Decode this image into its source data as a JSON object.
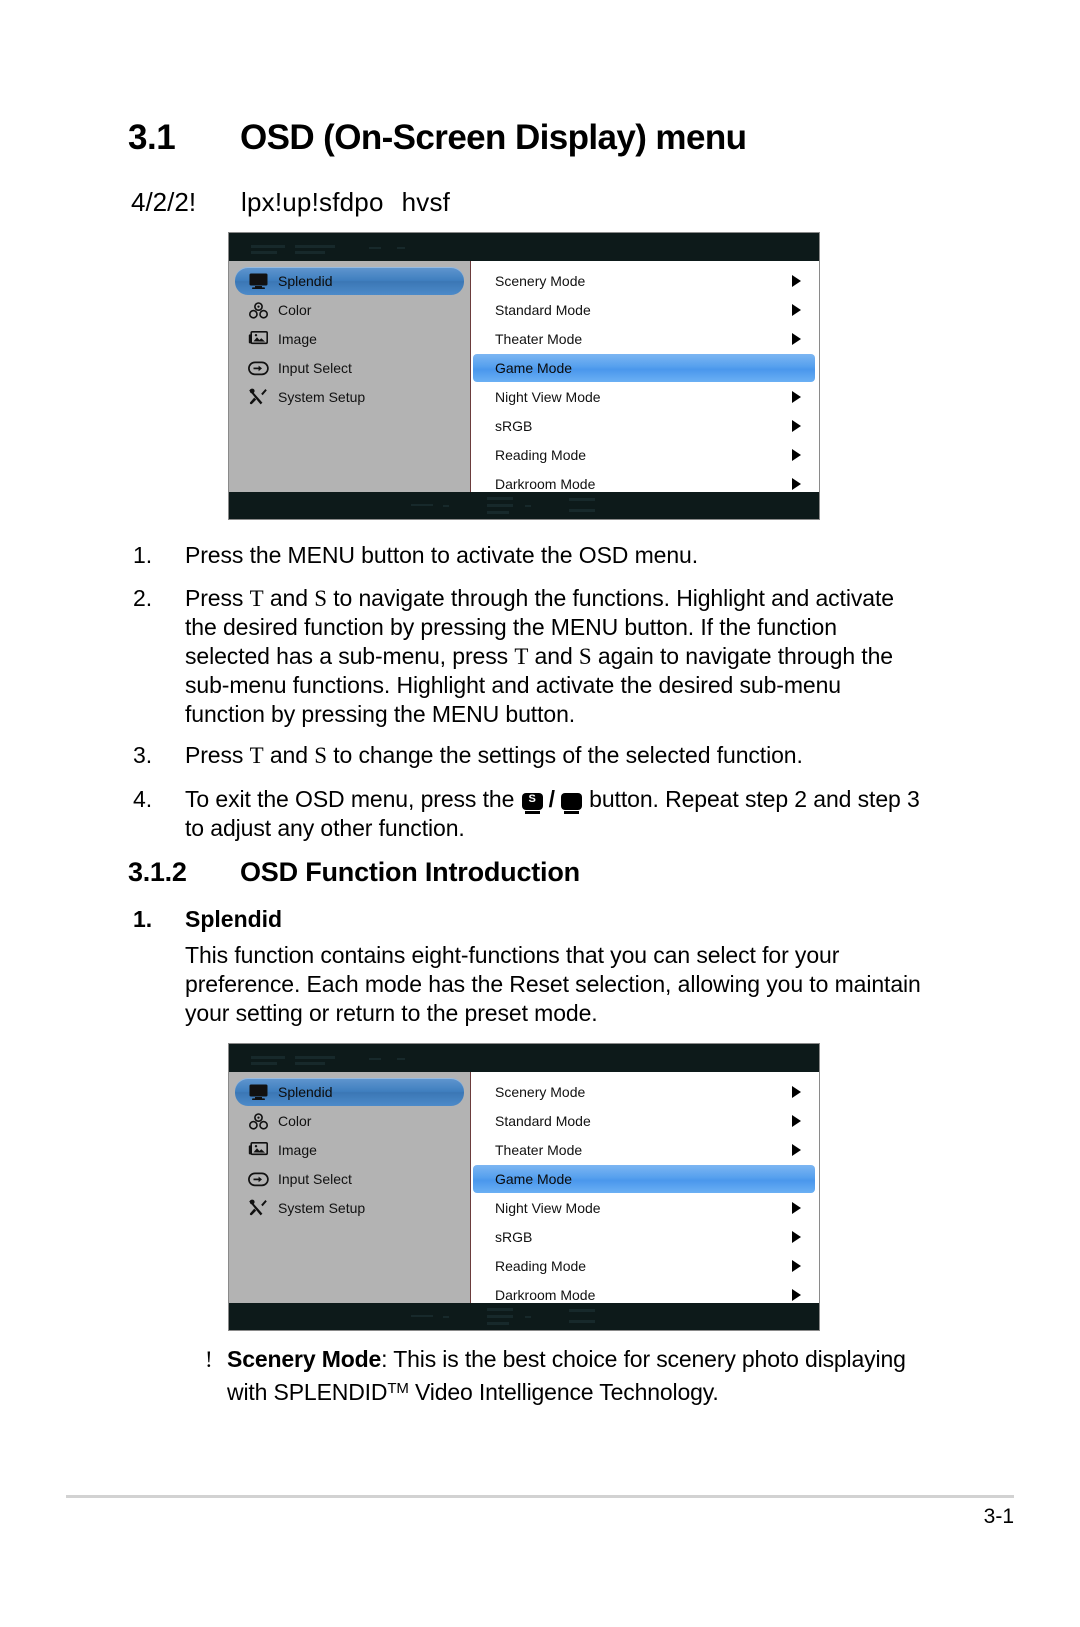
{
  "page": {
    "footer_page_number": "3-1"
  },
  "headings": {
    "section_number": "3.1",
    "section_title": "OSD (On-Screen Display) menu",
    "sub_number": "4/2/2!",
    "sub_title_a": "lpx!up!sfdpo",
    "sub_title_b": "hvsf",
    "func_number": "3.1.2",
    "func_title": "OSD Function Introduction"
  },
  "osd": {
    "brand": "",
    "left_menu": [
      {
        "label": "Splendid",
        "icon": "monitor-icon",
        "selected": true
      },
      {
        "label": "Color",
        "icon": "color-circles-icon",
        "selected": false
      },
      {
        "label": "Image",
        "icon": "picture-icon",
        "selected": false
      },
      {
        "label": "Input Select",
        "icon": "input-arrow-icon",
        "selected": false
      },
      {
        "label": "System Setup",
        "icon": "tools-icon",
        "selected": false
      }
    ],
    "right_menu": [
      {
        "label": "Scenery Mode",
        "selected": false
      },
      {
        "label": "Standard Mode",
        "selected": false
      },
      {
        "label": "Theater Mode",
        "selected": false
      },
      {
        "label": "Game Mode",
        "selected": true
      },
      {
        "label": "Night View Mode",
        "selected": false
      },
      {
        "label": "sRGB",
        "selected": false
      },
      {
        "label": "Reading Mode",
        "selected": false
      },
      {
        "label": "Darkroom Mode",
        "selected": false
      }
    ],
    "colors": {
      "chrome": "#0d1a1a",
      "left_panel": "#b3b3b3",
      "left_selected": "#3f7fbf",
      "right_selected": "#56a0ee",
      "right_panel": "#ffffff"
    }
  },
  "steps": [
    {
      "num": "1.",
      "text": "Press the MENU button to activate the OSD menu."
    },
    {
      "num": "2.",
      "text_1": "Press ",
      "sym_up": "T",
      "text_2": " and ",
      "sym_down": "S",
      "text_3": " to navigate through the functions. Highlight and activate the desired function by pressing the MENU button. If the function selected has a sub-menu, press ",
      "sym_up_2": "T",
      "text_4": " and ",
      "sym_down_2": "S",
      "text_5": " again to navigate through the sub-menu functions. Highlight and activate the desired sub-menu function by pressing the MENU button."
    },
    {
      "num": "3.",
      "text_1": "Press ",
      "sym_up": "T",
      "text_2": " and ",
      "sym_down": "S",
      "text_3": " to change the settings of the selected function."
    },
    {
      "num": "4.",
      "text_1": "To exit the OSD menu, press the ",
      "glyph_1": "S",
      "separator": "/",
      "glyph_2": "",
      "text_2": " button. Repeat step 2 and step 3 to adjust any other function."
    }
  ],
  "splendid": {
    "num": "1.",
    "title": "Splendid",
    "body": "This function contains eight-functions that you can select for your preference. Each mode has the Reset selection, allowing you to maintain your setting or return to the preset mode."
  },
  "scenery_bullet": {
    "marker": "!",
    "bold_label": "Scenery Mode",
    "text_1": ": This is the best choice for scenery photo displaying with SPLENDID",
    "trademark": "TM",
    "text_2": " Video Intelligence Technology."
  }
}
